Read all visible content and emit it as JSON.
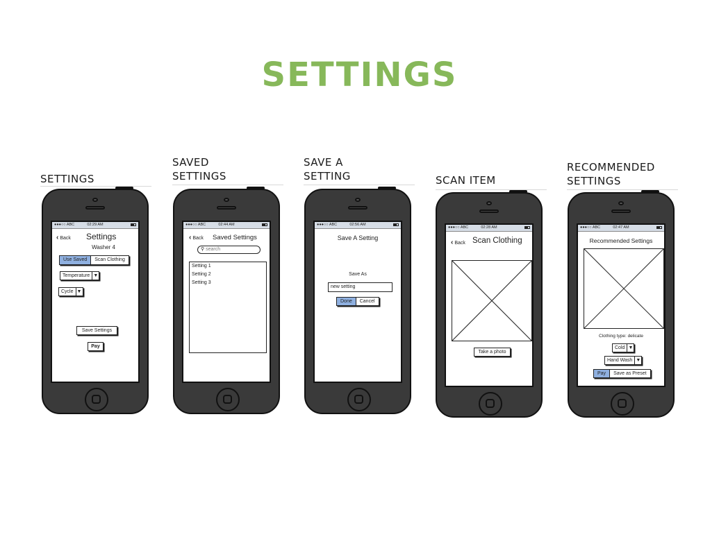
{
  "page_title": "SETTINGS",
  "columns": [
    {
      "label": "SETTINGS"
    },
    {
      "label": "SAVED\nSETTINGS"
    },
    {
      "label": "SAVE A\nSETTING"
    },
    {
      "label": "SCAN ITEM"
    },
    {
      "label": "RECOMMENDED\nSETTINGS"
    }
  ],
  "status_bar": {
    "carrier": "●●●○○ ABC"
  },
  "screens": {
    "settings": {
      "time": "02:29 AM",
      "back": "Back",
      "title": "Settings",
      "subtitle": "Washer 4",
      "seg_on": "Use Saved",
      "seg_off": "Scan Clothing",
      "temperature": "Temperature",
      "cycle": "Cycle",
      "save_settings": "Save Settings",
      "pay": "Pay"
    },
    "saved": {
      "time": "02:44 AM",
      "back": "Back",
      "title": "Saved Settings",
      "search_placeholder": "search",
      "items": [
        "Setting 1",
        "Setting 2",
        "Setting 3"
      ]
    },
    "save_a": {
      "time": "02:56 AM",
      "title": "Save A Setting",
      "save_as": "Save As",
      "input_value": "new setting",
      "done": "Done",
      "cancel": "Cancel"
    },
    "scan": {
      "time": "02:28 AM",
      "back": "Back",
      "title": "Scan Clothing",
      "take_photo": "Take a photo"
    },
    "recommended": {
      "time": "02:47 AM",
      "title": "Recommended Settings",
      "clothing_type": "Clothing type: delicate",
      "temp": "Cold",
      "cycle": "Hand Wash",
      "pay": "Pay",
      "save_preset": "Save as Preset"
    }
  },
  "colors": {
    "title_green": "#87b85a",
    "selected_blue": "#8fb0e0",
    "phone_body": "#3a3a3a"
  }
}
